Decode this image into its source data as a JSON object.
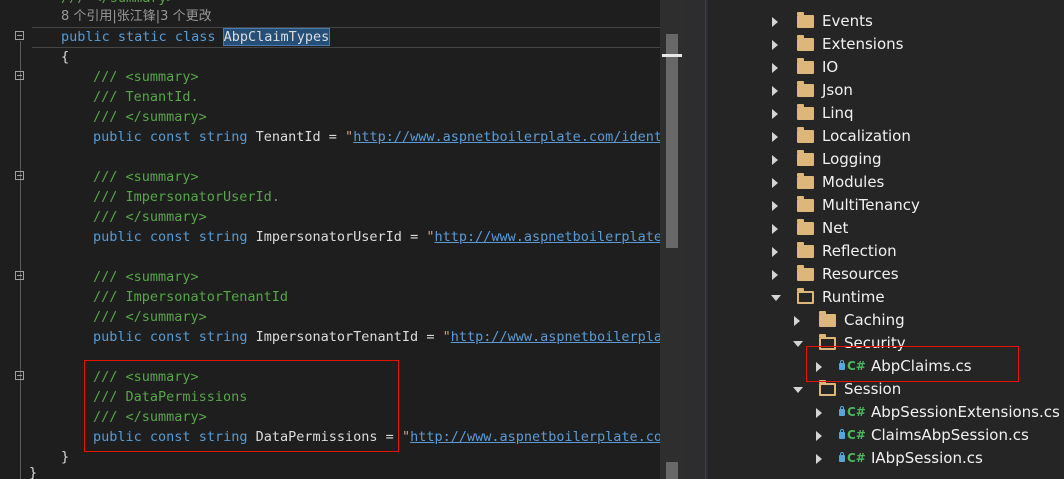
{
  "editor": {
    "codelens": "8 个引用|张江锋|3 个更改",
    "class_decl": {
      "kw1": "public",
      "kw2": "static",
      "kw3": "class",
      "name": "AbpClaimTypes"
    },
    "open_brace": "{",
    "close_brace": "}",
    "outer_close": "}",
    "doc_open": "/// <summary>",
    "doc_close": "/// </summary>",
    "doc_top_partial": "/// </summary>",
    "members": [
      {
        "comment": "/// TenantId.",
        "kw1": "public",
        "kw2": "const",
        "kw3": "string",
        "name": "TenantId",
        "eq": " = ",
        "quote": "\"",
        "url": "http://www.aspnetboilerplate.com/identi"
      },
      {
        "comment": "/// ImpersonatorUserId.",
        "kw1": "public",
        "kw2": "const",
        "kw3": "string",
        "name": "ImpersonatorUserId",
        "eq": " = ",
        "quote": "\"",
        "url": "http://www.aspnetboilerplate."
      },
      {
        "comment": "/// ImpersonatorTenantId",
        "kw1": "public",
        "kw2": "const",
        "kw3": "string",
        "name": "ImpersonatorTenantId",
        "eq": " = ",
        "quote": "\"",
        "url": "http://www.aspnetboilerplat"
      },
      {
        "comment": "/// DataPermissions",
        "kw1": "public",
        "kw2": "const",
        "kw3": "string",
        "name": "DataPermissions",
        "eq": " = ",
        "quote": "\"",
        "url": "http://www.aspnetboilerplate.com"
      }
    ]
  },
  "solution_explorer": {
    "nodes": [
      {
        "label": "Events",
        "kind": "folder",
        "state": "collapsed"
      },
      {
        "label": "Extensions",
        "kind": "folder",
        "state": "collapsed"
      },
      {
        "label": "IO",
        "kind": "folder",
        "state": "collapsed"
      },
      {
        "label": "Json",
        "kind": "folder",
        "state": "collapsed"
      },
      {
        "label": "Linq",
        "kind": "folder",
        "state": "collapsed"
      },
      {
        "label": "Localization",
        "kind": "folder",
        "state": "collapsed"
      },
      {
        "label": "Logging",
        "kind": "folder",
        "state": "collapsed"
      },
      {
        "label": "Modules",
        "kind": "folder",
        "state": "collapsed"
      },
      {
        "label": "MultiTenancy",
        "kind": "folder",
        "state": "collapsed"
      },
      {
        "label": "Net",
        "kind": "folder",
        "state": "collapsed"
      },
      {
        "label": "Reflection",
        "kind": "folder",
        "state": "collapsed"
      },
      {
        "label": "Resources",
        "kind": "folder",
        "state": "collapsed"
      },
      {
        "label": "Runtime",
        "kind": "folder",
        "state": "expanded"
      },
      {
        "label": "Caching",
        "kind": "folder",
        "state": "collapsed"
      },
      {
        "label": "Security",
        "kind": "folder",
        "state": "expanded"
      },
      {
        "label": "AbpClaims.cs",
        "kind": "cs-file",
        "state": "collapsed"
      },
      {
        "label": "Session",
        "kind": "folder",
        "state": "expanded"
      },
      {
        "label": "AbpSessionExtensions.cs",
        "kind": "cs-file",
        "state": "collapsed"
      },
      {
        "label": "ClaimsAbpSession.cs",
        "kind": "cs-file",
        "state": "collapsed"
      },
      {
        "label": "IAbpSession.cs",
        "kind": "cs-file",
        "state": "collapsed"
      }
    ],
    "cs_badge": "C#"
  },
  "colors": {
    "editor_bg": "#1e1e1e",
    "keyword": "#569cd6",
    "comment": "#57a64a",
    "link": "#5c9bd6",
    "highlight_box": "#e51400",
    "folder": "#dcb67a"
  }
}
